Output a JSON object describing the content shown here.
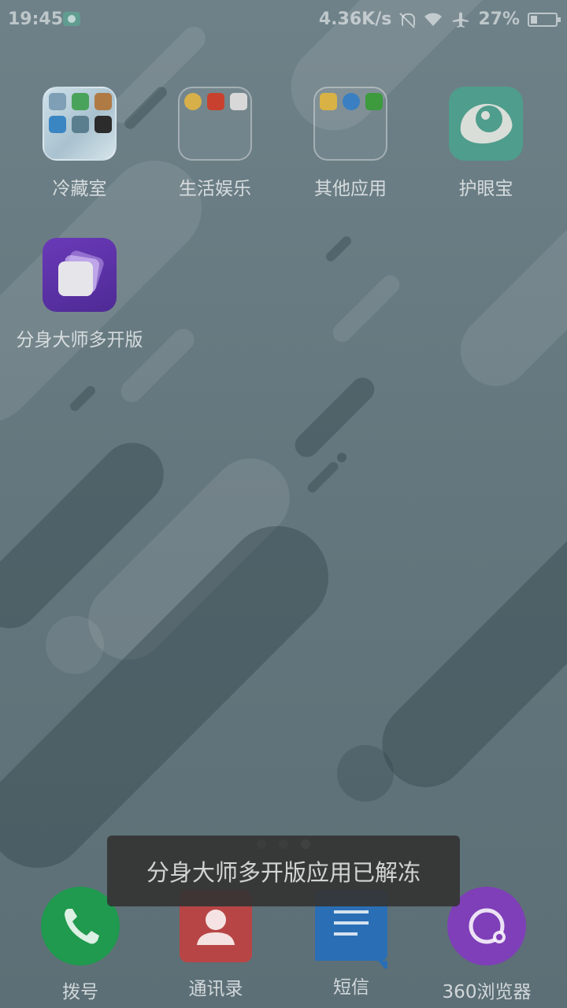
{
  "status_bar": {
    "time": "19:45",
    "net_speed": "4.36K/s",
    "battery_percent": "27%",
    "battery_level": 0.27
  },
  "apps": [
    {
      "label": "冷藏室"
    },
    {
      "label": "生活娱乐"
    },
    {
      "label": "其他应用"
    },
    {
      "label": "护眼宝"
    },
    {
      "label": "分身大师多开版"
    }
  ],
  "page_indicator": {
    "pages": 3,
    "active": 3
  },
  "dock": [
    {
      "label": "拨号"
    },
    {
      "label": "通讯录"
    },
    {
      "label": "短信"
    },
    {
      "label": "360浏览器"
    }
  ],
  "toast": {
    "message": "分身大师多开版应用已解冻"
  },
  "colors": {
    "dial": "#1f9a4e",
    "contacts": "#b84545",
    "sms": "#2a6fb5",
    "browser": "#7f3fb8",
    "eye_app": "#4f9d8c",
    "clone_app": "#5a30a5"
  }
}
